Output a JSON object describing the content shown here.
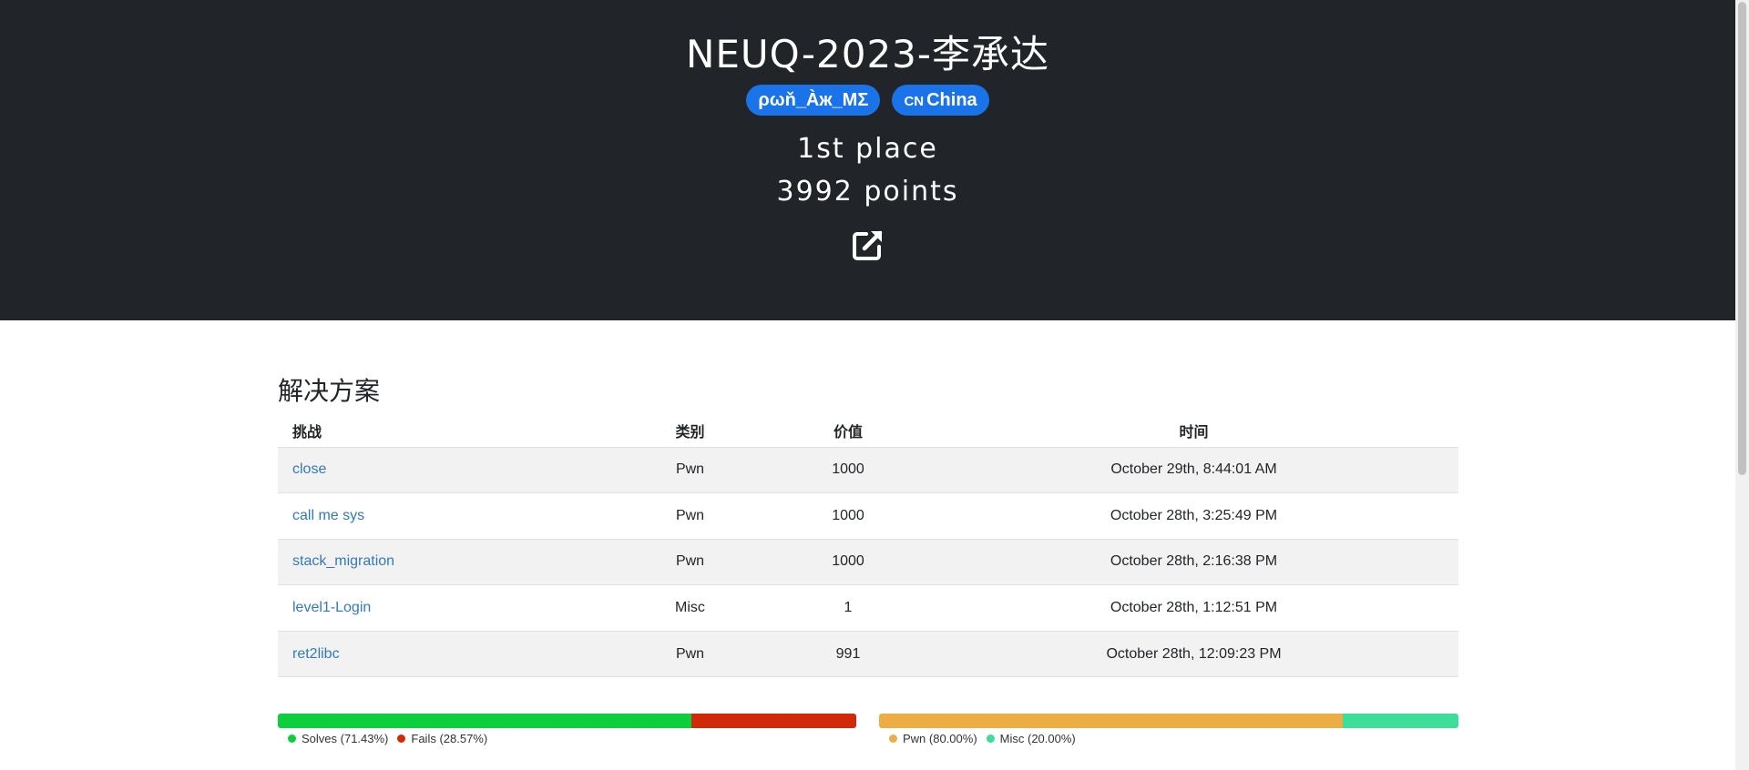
{
  "team": {
    "name": "NEUQ-2023-李承达",
    "affiliation": "ρωň_Àж_MΣ",
    "country_code": "CN",
    "country": "China",
    "place": "1st place",
    "points": "3992 points",
    "link_icon": "external-link-icon"
  },
  "solves": {
    "title": "解决方案",
    "headers": {
      "challenge": "挑战",
      "category": "类别",
      "value": "价值",
      "time": "时间"
    },
    "rows": [
      {
        "challenge": "close",
        "category": "Pwn",
        "value": "1000",
        "time": "October 29th, 8:44:01 AM"
      },
      {
        "challenge": "call me sys",
        "category": "Pwn",
        "value": "1000",
        "time": "October 28th, 3:25:49 PM"
      },
      {
        "challenge": "stack_migration",
        "category": "Pwn",
        "value": "1000",
        "time": "October 28th, 2:16:38 PM"
      },
      {
        "challenge": "level1-Login",
        "category": "Misc",
        "value": "1",
        "time": "October 28th, 1:12:51 PM"
      },
      {
        "challenge": "ret2libc",
        "category": "Pwn",
        "value": "991",
        "time": "October 28th, 12:09:23 PM"
      }
    ]
  },
  "charts": {
    "solve_percentages": {
      "segments": [
        {
          "label": "Solves (71.43%)",
          "value": 71.43,
          "color": "#0dcf3d"
        },
        {
          "label": "Fails (28.57%)",
          "value": 28.57,
          "color": "#d12a0a"
        }
      ]
    },
    "category_breakdown": {
      "segments": [
        {
          "label": "Pwn (80.00%)",
          "value": 80.0,
          "color": "#ecad45"
        },
        {
          "label": "Misc (20.00%)",
          "value": 20.0,
          "color": "#3cde9a"
        }
      ]
    }
  },
  "colors": {
    "hero_background": "#212529",
    "badge": "#1a73e8",
    "link": "#337ab7"
  }
}
